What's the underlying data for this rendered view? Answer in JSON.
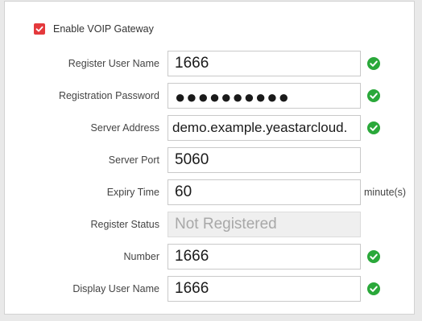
{
  "enable": {
    "label": "Enable VOIP Gateway",
    "checked": true
  },
  "fields": {
    "register_user_name": {
      "label": "Register User Name",
      "value": "1666"
    },
    "registration_password": {
      "label": "Registration Password",
      "value": "●●●●●●●●●●"
    },
    "server_address": {
      "label": "Server Address",
      "value": "demo.example.yeastarcloud."
    },
    "server_port": {
      "label": "Server Port",
      "value": "5060"
    },
    "expiry_time": {
      "label": "Expiry Time",
      "value": "60",
      "unit": "minute(s)"
    },
    "register_status": {
      "label": "Register Status",
      "value": "Not Registered"
    },
    "number": {
      "label": "Number",
      "value": "1666"
    },
    "display_user_name": {
      "label": "Display User Name",
      "value": "1666"
    }
  },
  "colors": {
    "accent_red": "#e4393c",
    "valid_green": "#2aa83a"
  },
  "icons": {
    "checkbox": "checkmark-icon",
    "valid": "valid-check-icon"
  }
}
